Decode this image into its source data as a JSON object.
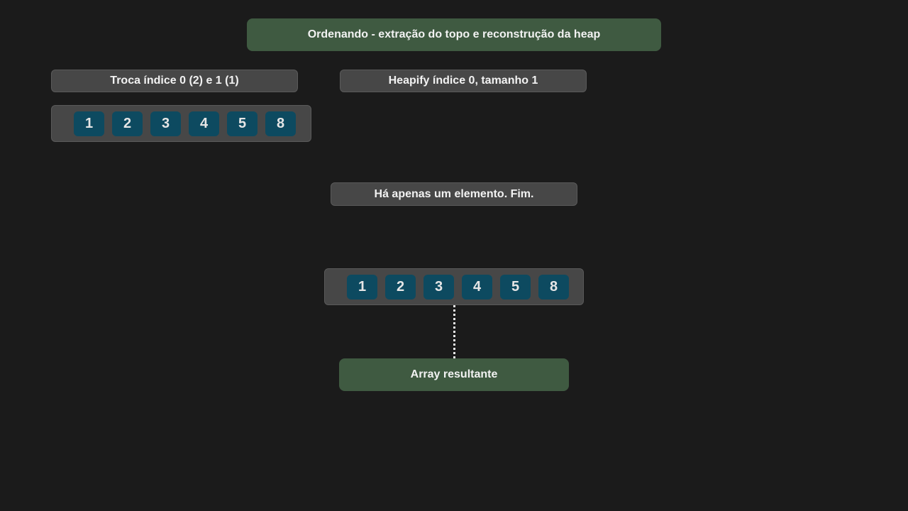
{
  "title": "Ordenando - extração do topo e reconstrução da heap",
  "step_swap": "Troca índice 0 (2) e 1 (1)",
  "step_heapify": "Heapify índice 0, tamanho 1",
  "array_top": [
    "1",
    "2",
    "3",
    "4",
    "5",
    "8"
  ],
  "message": "Há apenas um elemento. Fim.",
  "array_result": [
    "1",
    "2",
    "3",
    "4",
    "5",
    "8"
  ],
  "result_label": "Array resultante",
  "colors": {
    "background": "#1b1b1b",
    "label_green": "#3f5a41",
    "label_grey": "#474747",
    "cell": "#0d4a60"
  }
}
